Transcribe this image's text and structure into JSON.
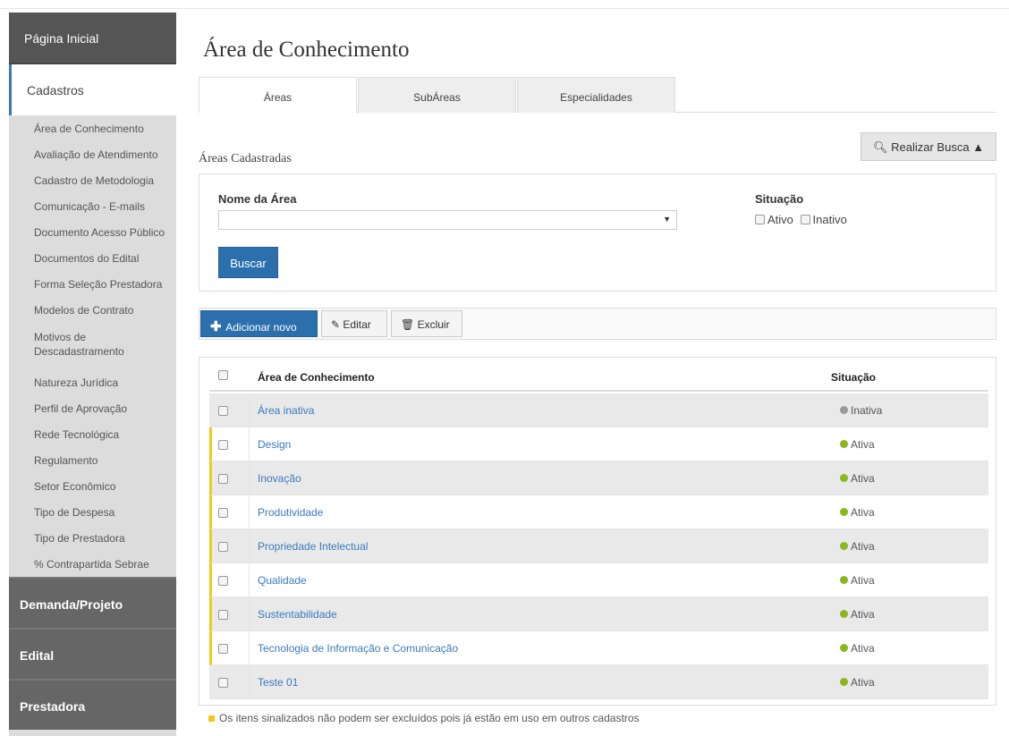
{
  "sidebar": {
    "home": "Página Inicial",
    "active_section": "Cadastros",
    "sub_items": [
      "Área de Conhecimento",
      "Avaliação de Atendimento",
      "Cadastro de Metodologia",
      "Comunicação - E-mails",
      "Documento Acesso Público",
      "Documentos do Edital",
      "Forma Seleção Prestadora",
      "Modelos de Contrato",
      "Motivos de Descadastramento",
      "Natureza Jurídica",
      "Perfil de Aprovação",
      "Rede Tecnológica",
      "Regulamento",
      "Setor Econômico",
      "Tipo de Despesa",
      "Tipo de Prestadora",
      "% Contrapartida Sebrae"
    ],
    "sections": [
      "Demanda/Projeto",
      "Edital",
      "Prestadora"
    ]
  },
  "page": {
    "title": "Área de Conhecimento",
    "tabs": [
      "Áreas",
      "SubÁreas",
      "Especialidades"
    ],
    "active_tab": "Áreas",
    "section_label": "Áreas Cadastradas",
    "search_toggle": "Realizar Busca"
  },
  "filter": {
    "name_label": "Nome da Área",
    "name_value": "",
    "status_label": "Situação",
    "opt_active": "Ativo",
    "opt_inactive": "Inativo",
    "search_button": "Buscar"
  },
  "toolbar": {
    "add": "Adicionar novo",
    "edit": "Editar",
    "delete": "Excluir"
  },
  "table": {
    "columns": [
      "Área de Conhecimento",
      "Situação"
    ],
    "rows": [
      {
        "name": "Área inativa",
        "status": "Inativa",
        "active": false,
        "in_use": false
      },
      {
        "name": "Design",
        "status": "Ativa",
        "active": true,
        "in_use": true
      },
      {
        "name": "Inovação",
        "status": "Ativa",
        "active": true,
        "in_use": true
      },
      {
        "name": "Produtividade",
        "status": "Ativa",
        "active": true,
        "in_use": true
      },
      {
        "name": "Propriedade Intelectual",
        "status": "Ativa",
        "active": true,
        "in_use": true
      },
      {
        "name": "Qualidade",
        "status": "Ativa",
        "active": true,
        "in_use": true
      },
      {
        "name": "Sustentabilidade",
        "status": "Ativa",
        "active": true,
        "in_use": true
      },
      {
        "name": "Tecnologia de Informação e Comunicação",
        "status": "Ativa",
        "active": true,
        "in_use": true
      },
      {
        "name": "Teste 01",
        "status": "Ativa",
        "active": true,
        "in_use": false
      }
    ]
  },
  "footnote": "Os itens sinalizados não podem ser excluídos pois já estão em uso em outros cadastros",
  "colors": {
    "primary": "#2c6fad",
    "active_status": "#8cb61d",
    "inactive_status": "#999999",
    "in_use_marker": "#f2c919",
    "link": "#3a7abf"
  }
}
